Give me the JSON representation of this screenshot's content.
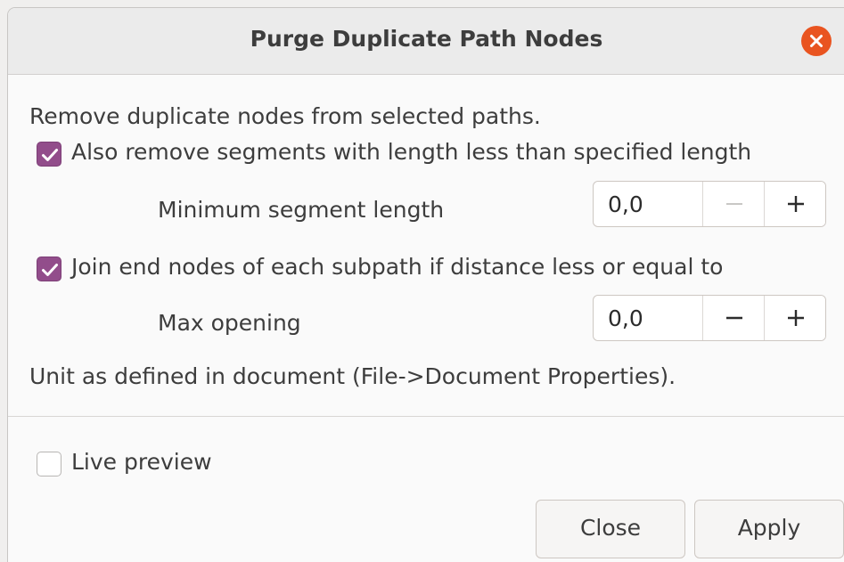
{
  "window": {
    "title": "Purge Duplicate Path Nodes",
    "close_icon": "close-icon",
    "accent_color": "#e95420"
  },
  "content": {
    "description": "Remove duplicate nodes from selected paths.",
    "option_remove_segments": {
      "label": "Also remove segments with length less than specified length",
      "checked": true
    },
    "min_segment_length": {
      "label": "Minimum segment length",
      "value": "0,0",
      "decrement_enabled": false,
      "increment_enabled": true
    },
    "option_join_end_nodes": {
      "label": "Join end nodes of each subpath if distance less or equal to",
      "checked": true
    },
    "max_opening": {
      "label": "Max opening",
      "value": "0,0",
      "decrement_enabled": true,
      "increment_enabled": true
    },
    "unit_note": "Unit as defined in document (File->Document Properties).",
    "live_preview": {
      "label": "Live preview",
      "checked": false
    }
  },
  "buttons": {
    "close_label": "Close",
    "apply_label": "Apply"
  },
  "colors": {
    "checkbox_checked": "#924d8b"
  }
}
